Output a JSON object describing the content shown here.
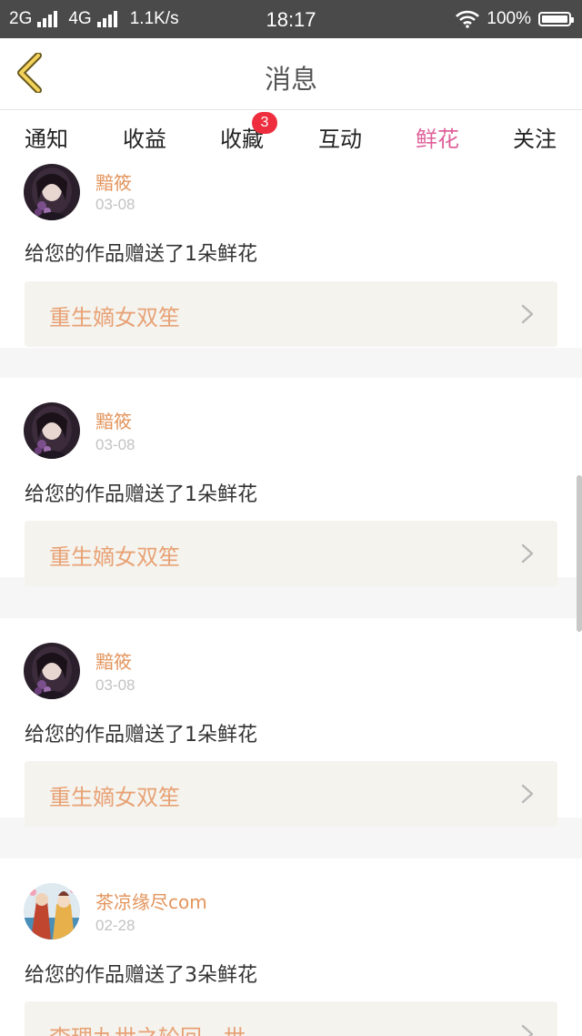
{
  "status_bar": {
    "network_a": "2G",
    "network_b": "4G",
    "speed": "1.1K/s",
    "time": "18:17",
    "battery": "100%"
  },
  "header": {
    "title": "消息"
  },
  "tabs": [
    {
      "label": "通知"
    },
    {
      "label": "收益"
    },
    {
      "label": "收藏",
      "badge": "3"
    },
    {
      "label": "互动"
    },
    {
      "label": "鲜花",
      "active": true
    },
    {
      "label": "关注"
    }
  ],
  "notifications": [
    {
      "sender": "黯筱",
      "date": "03-08",
      "message": "给您的作品赠送了1朵鲜花",
      "work_title": "重生嫡女双笙"
    },
    {
      "sender": "黯筱",
      "date": "03-08",
      "message": "给您的作品赠送了1朵鲜花",
      "work_title": "重生嫡女双笙"
    },
    {
      "sender": "黯筱",
      "date": "03-08",
      "message": "给您的作品赠送了1朵鲜花",
      "work_title": "重生嫡女双笙"
    },
    {
      "sender": "茶凉缘尽com",
      "date": "02-28",
      "message": "给您的作品赠送了3朵鲜花",
      "work_title": "李理九世之轮回一世"
    }
  ],
  "colors": {
    "accent": "#e0609a",
    "sender": "#e3945c",
    "work_title": "#e8a275",
    "badge": "#ee2e3e"
  }
}
